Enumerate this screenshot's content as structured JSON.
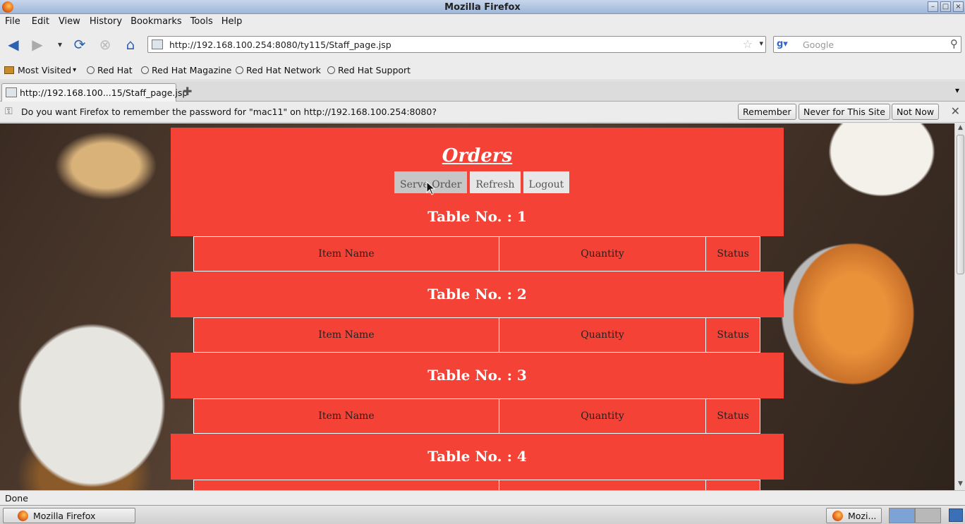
{
  "window": {
    "title": "Mozilla Firefox"
  },
  "menu": [
    "File",
    "Edit",
    "View",
    "History",
    "Bookmarks",
    "Tools",
    "Help"
  ],
  "nav": {
    "url": "http://192.168.100.254:8080/ty115/Staff_page.jsp",
    "search_placeholder": "Google",
    "icons": [
      "back-arrow-icon",
      "forward-arrow-icon",
      "history-dropdown-icon",
      "reload-icon",
      "stop-icon",
      "home-icon"
    ]
  },
  "bookmarks": [
    {
      "label": "Most Visited",
      "icon": "folder-icon"
    },
    {
      "label": "Red Hat",
      "icon": "bookmark-icon"
    },
    {
      "label": "Red Hat Magazine",
      "icon": "bookmark-icon"
    },
    {
      "label": "Red Hat Network",
      "icon": "bookmark-icon"
    },
    {
      "label": "Red Hat Support",
      "icon": "bookmark-icon"
    }
  ],
  "tabs": [
    {
      "label": "http://192.168.100...15/Staff_page.jsp"
    }
  ],
  "notification": {
    "message": "Do you want Firefox to remember the password for \"mac11\" on http://192.168.100.254:8080?",
    "remember": "Remember",
    "never": "Never for This Site",
    "not_now": "Not Now"
  },
  "page": {
    "title": "Orders",
    "buttons": {
      "serve": "Serve Order",
      "refresh": "Refresh",
      "logout": "Logout"
    },
    "columns": {
      "item": "Item Name",
      "qty": "Quantity",
      "status": "Status"
    },
    "tables": [
      {
        "label": "Table No. : 1"
      },
      {
        "label": "Table No. : 2"
      },
      {
        "label": "Table No. : 3"
      },
      {
        "label": "Table No. : 4"
      }
    ],
    "colors": {
      "panel": "#f44336",
      "button": "#e7e7e7"
    }
  },
  "status": {
    "text": "Done"
  },
  "taskbar": {
    "main_task": "Mozilla Firefox",
    "tray_task": "Mozi..."
  }
}
